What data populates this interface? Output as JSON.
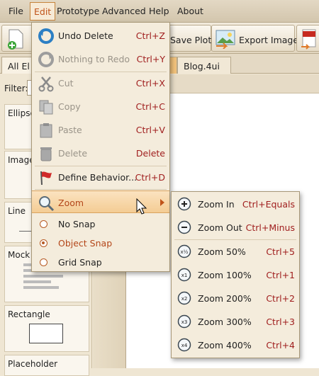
{
  "menubar": {
    "items": [
      "File",
      "Edit",
      "Prototype",
      "Advanced",
      "Help",
      "About"
    ]
  },
  "toolbar": {
    "save_plot_label": "Save Plot",
    "export_image_label": "Export Image"
  },
  "tabs": {
    "all_elements_label": "All El",
    "document_label": "Blog.4ui"
  },
  "left_panel": {
    "filter_label": "Filter:",
    "components": [
      "Ellipse",
      "Image",
      "Line",
      "Mock T",
      "Rectangle",
      "Placeholder"
    ]
  },
  "edit_menu": {
    "items": [
      {
        "label": "Undo Delete",
        "shortcut": "Ctrl+Z",
        "icon": "undo-icon",
        "enabled": true
      },
      {
        "label": "Nothing to Redo",
        "shortcut": "Ctrl+Y",
        "icon": "redo-icon",
        "enabled": false
      },
      {
        "label": "Cut",
        "shortcut": "Ctrl+X",
        "icon": "scissors-icon",
        "enabled": false
      },
      {
        "label": "Copy",
        "shortcut": "Ctrl+C",
        "icon": "copy-icon",
        "enabled": false
      },
      {
        "label": "Paste",
        "shortcut": "Ctrl+V",
        "icon": "clipboard-icon",
        "enabled": false
      },
      {
        "label": "Delete",
        "shortcut": "Delete",
        "icon": "trash-icon",
        "enabled": false
      },
      {
        "label": "Define Behavior...",
        "shortcut": "Ctrl+D",
        "icon": "flag-icon",
        "enabled": true
      },
      {
        "label": "Zoom",
        "icon": "magnifier-icon",
        "highlighted": true
      },
      {
        "label": "No Snap",
        "radio": false
      },
      {
        "label": "Object Snap",
        "radio": true
      },
      {
        "label": "Grid Snap",
        "radio": false
      }
    ]
  },
  "zoom_menu": {
    "items": [
      {
        "label": "Zoom In",
        "shortcut": "Ctrl+Equals",
        "icon_text": "+"
      },
      {
        "label": "Zoom Out",
        "shortcut": "Ctrl+Minus",
        "icon_text": "−"
      },
      {
        "label": "Zoom 50%",
        "shortcut": "Ctrl+5",
        "icon_text": "x½"
      },
      {
        "label": "Zoom 100%",
        "shortcut": "Ctrl+1",
        "icon_text": "x1"
      },
      {
        "label": "Zoom 200%",
        "shortcut": "Ctrl+2",
        "icon_text": "x2"
      },
      {
        "label": "Zoom 300%",
        "shortcut": "Ctrl+3",
        "icon_text": "x3"
      },
      {
        "label": "Zoom 400%",
        "shortcut": "Ctrl+4",
        "icon_text": "x4"
      }
    ]
  },
  "colors": {
    "accent": "#c0531a",
    "shortcut": "#a01e1e",
    "highlight": "#f4cc94"
  }
}
